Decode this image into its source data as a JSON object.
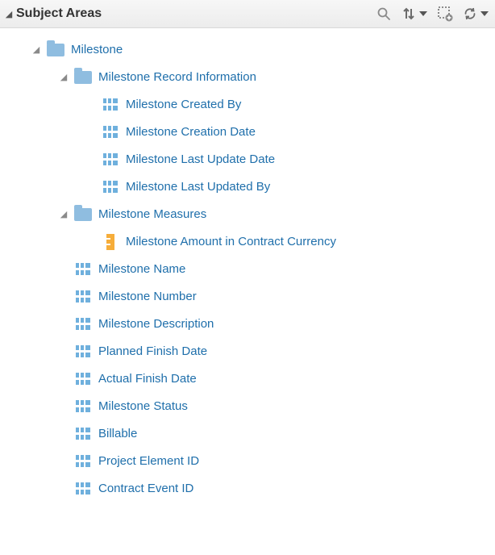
{
  "header": {
    "title": "Subject Areas"
  },
  "tree": {
    "milestone": {
      "label": "Milestone",
      "record_info": {
        "label": "Milestone Record Information",
        "created_by": "Milestone Created By",
        "creation_date": "Milestone Creation Date",
        "last_update_date": "Milestone Last Update Date",
        "last_updated_by": "Milestone Last Updated By"
      },
      "measures": {
        "label": "Milestone Measures",
        "amount_contract_currency": "Milestone Amount in Contract Currency"
      },
      "name": "Milestone Name",
      "number": "Milestone Number",
      "description": "Milestone Description",
      "planned_finish": "Planned Finish Date",
      "actual_finish": "Actual Finish Date",
      "status": "Milestone Status",
      "billable": "Billable",
      "project_element_id": "Project Element ID",
      "contract_event_id": "Contract Event ID"
    }
  }
}
